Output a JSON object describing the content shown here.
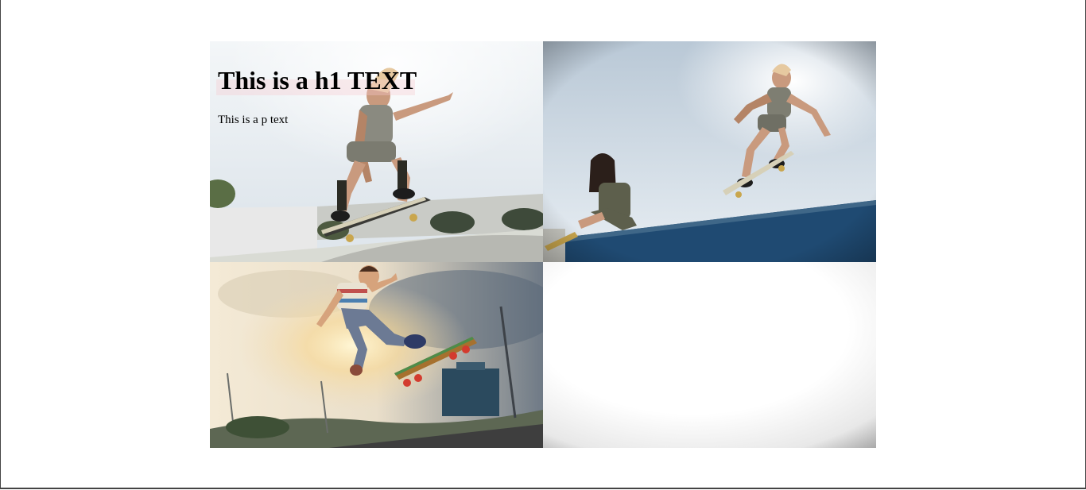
{
  "heading": "This is a h1 TEXT",
  "paragraph": "This is a p text",
  "images": [
    {
      "name": "skater-ollie-park"
    },
    {
      "name": "skater-ramp-friend"
    },
    {
      "name": "kid-skater-sunset"
    },
    {
      "name": "blank-vignette"
    }
  ]
}
